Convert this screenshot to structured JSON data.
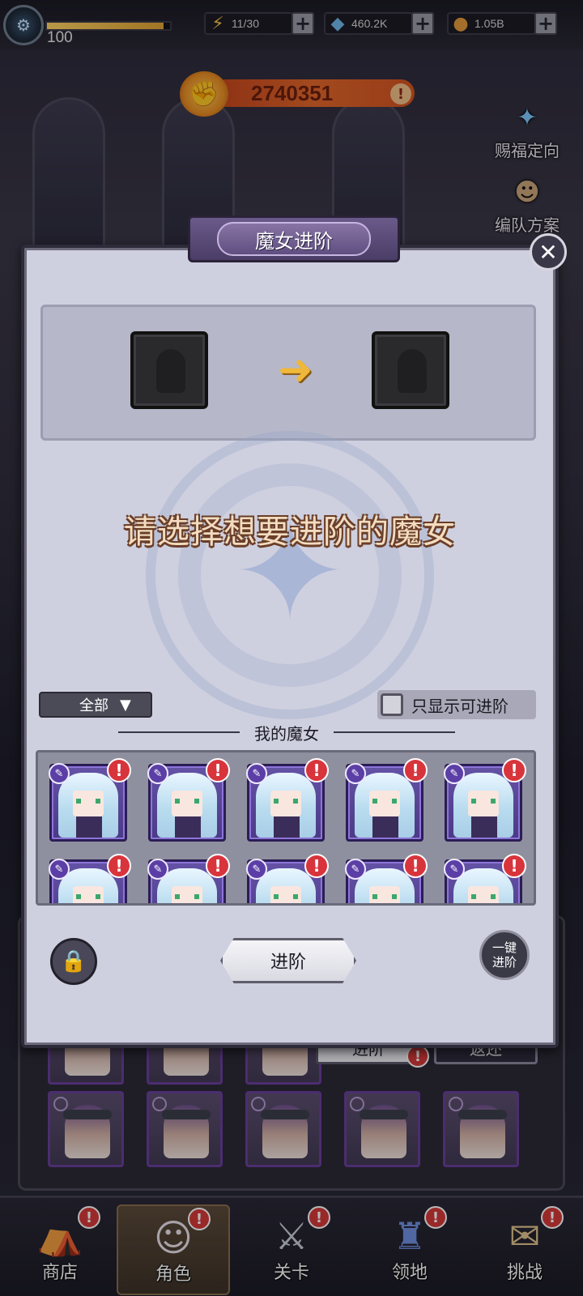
{
  "topbar": {
    "level": "100",
    "level_progress": 0.95,
    "energy": "11/30",
    "diamonds": "460.2K",
    "coins": "1.05B"
  },
  "power": {
    "value": "2740351",
    "info_icon": "!"
  },
  "side_buttons": {
    "blessing": "赐福定向",
    "formation": "编队方案"
  },
  "modal": {
    "title": "魔女进阶",
    "close_icon": "close-icon",
    "prompt": "请选择想要进阶的魔女",
    "filter": {
      "selected": "全部"
    },
    "only_advanceable_label": "只显示可进阶",
    "only_advanceable_checked": false,
    "section_title": "我的魔女",
    "witch_count_visible": 10,
    "witch_badge": "!",
    "advance_button": "进阶",
    "one_click_line1": "一键",
    "one_click_line2": "进阶"
  },
  "behind_tabs": {
    "advance": "进阶",
    "return": "返还"
  },
  "bottom_nav": {
    "items": [
      {
        "label": "商店",
        "icon": "shop-icon"
      },
      {
        "label": "角色",
        "icon": "character-icon"
      },
      {
        "label": "关卡",
        "icon": "stage-icon"
      },
      {
        "label": "领地",
        "icon": "territory-icon"
      },
      {
        "label": "挑战",
        "icon": "challenge-icon"
      }
    ],
    "active": "角色"
  },
  "colors": {
    "modal_bg": "#cfd0df",
    "accent_purple": "#5f4f80",
    "power_orange": "#e2672b",
    "alert_red": "#d8343c"
  }
}
